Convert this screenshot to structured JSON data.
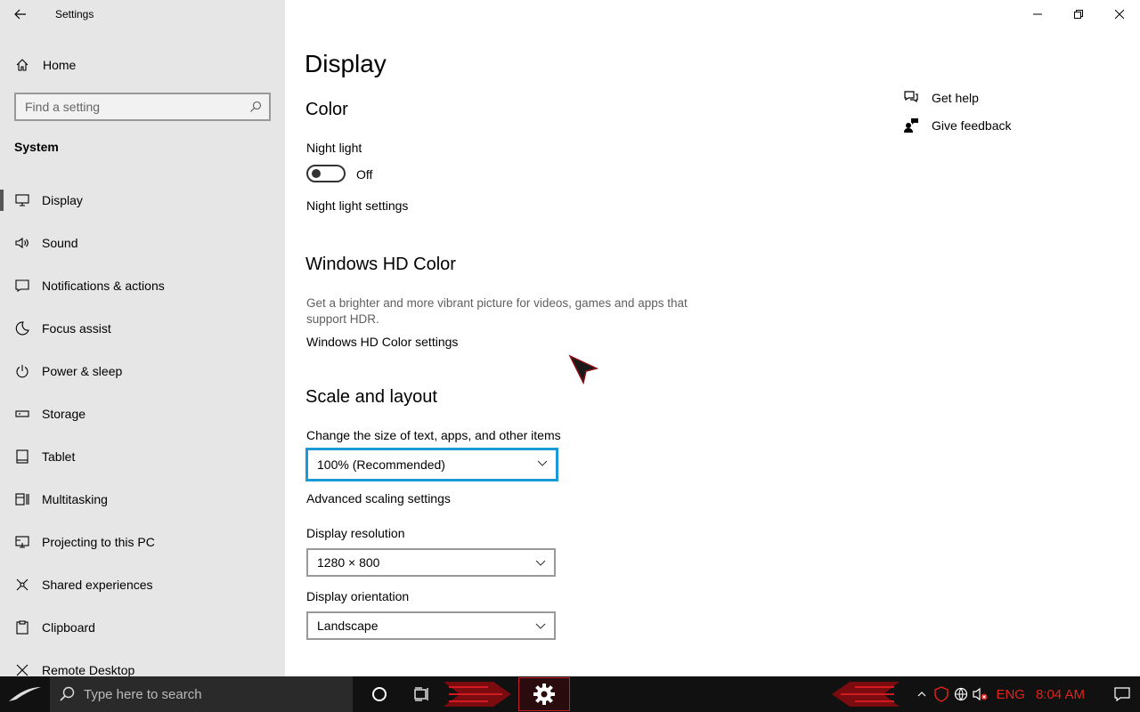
{
  "window": {
    "title": "Settings"
  },
  "sidebar": {
    "home_label": "Home",
    "search_placeholder": "Find a setting",
    "section": "System",
    "items": [
      {
        "label": "Display",
        "icon": "monitor-icon"
      },
      {
        "label": "Sound",
        "icon": "speaker-icon"
      },
      {
        "label": "Notifications & actions",
        "icon": "notification-icon"
      },
      {
        "label": "Focus assist",
        "icon": "moon-icon"
      },
      {
        "label": "Power & sleep",
        "icon": "power-icon"
      },
      {
        "label": "Storage",
        "icon": "storage-icon"
      },
      {
        "label": "Tablet",
        "icon": "tablet-icon"
      },
      {
        "label": "Multitasking",
        "icon": "multitasking-icon"
      },
      {
        "label": "Projecting to this PC",
        "icon": "projecting-icon"
      },
      {
        "label": "Shared experiences",
        "icon": "shared-icon"
      },
      {
        "label": "Clipboard",
        "icon": "clipboard-icon"
      },
      {
        "label": "Remote Desktop",
        "icon": "remote-desktop-icon"
      }
    ]
  },
  "main": {
    "title": "Display",
    "color": {
      "heading": "Color",
      "night_light_label": "Night light",
      "night_light_state": "Off",
      "night_light_on": false,
      "night_light_settings": "Night light settings"
    },
    "hdr": {
      "heading": "Windows HD Color",
      "description": "Get a brighter and more vibrant picture for videos, games and apps that support HDR.",
      "settings_link": "Windows HD Color settings"
    },
    "scale": {
      "heading": "Scale and layout",
      "size_label": "Change the size of text, apps, and other items",
      "size_value": "100% (Recommended)",
      "advanced_link": "Advanced scaling settings",
      "resolution_label": "Display resolution",
      "resolution_value": "1280 × 800",
      "orientation_label": "Display orientation",
      "orientation_value": "Landscape"
    },
    "help": {
      "get_help": "Get help",
      "give_feedback": "Give feedback"
    }
  },
  "taskbar": {
    "search_placeholder": "Type here to search",
    "language": "ENG",
    "time": "8:04 AM"
  },
  "colors": {
    "sidebar_bg": "#e6e6e6",
    "focus_border": "#1a9bd7",
    "taskbar_bg": "#111111",
    "tray_accent": "#e2231a"
  }
}
